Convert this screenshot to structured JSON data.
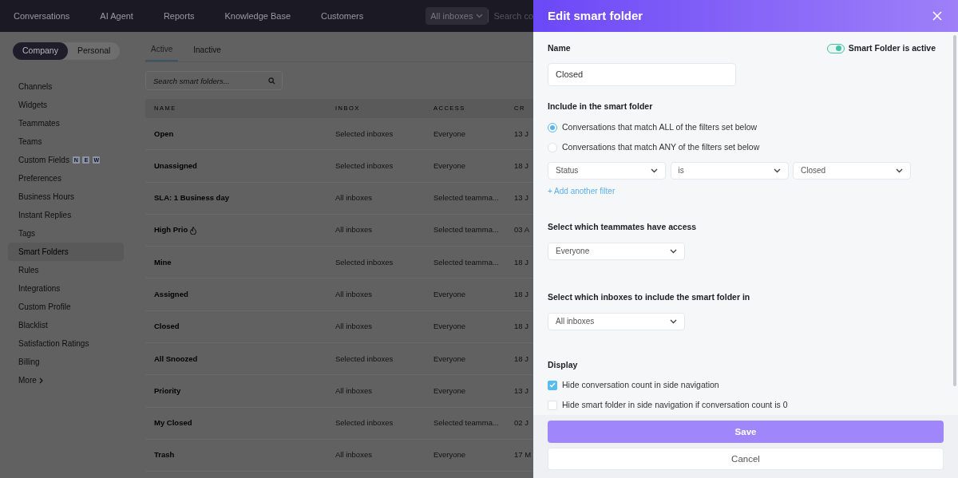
{
  "top_nav": {
    "items": [
      "Conversations",
      "AI Agent",
      "Reports",
      "Knowledge Base",
      "Customers"
    ],
    "inbox_select": "All inboxes",
    "search_placeholder": "Search co"
  },
  "scope_toggle": [
    {
      "label": "Company",
      "selected": true
    },
    {
      "label": "Personal",
      "selected": false
    }
  ],
  "sidebar": {
    "items": [
      {
        "label": "Channels",
        "selected": false
      },
      {
        "label": "Widgets",
        "selected": false
      },
      {
        "label": "Teammates",
        "selected": false
      },
      {
        "label": "Teams",
        "selected": false
      },
      {
        "label": "Custom Fields",
        "selected": false,
        "badge": [
          "N",
          "E",
          "W"
        ]
      },
      {
        "label": "Preferences",
        "selected": false
      },
      {
        "label": "Business Hours",
        "selected": false
      },
      {
        "label": "Instant Replies",
        "selected": false
      },
      {
        "label": "Tags",
        "selected": false
      },
      {
        "label": "Smart Folders",
        "selected": true
      },
      {
        "label": "Rules",
        "selected": false
      },
      {
        "label": "Integrations",
        "selected": false
      },
      {
        "label": "Custom Profile",
        "selected": false
      },
      {
        "label": "Blacklist",
        "selected": false
      },
      {
        "label": "Satisfaction Ratings",
        "selected": false
      },
      {
        "label": "Billing",
        "selected": false
      }
    ],
    "more": "More"
  },
  "tabs": [
    {
      "label": "Active",
      "selected": true
    },
    {
      "label": "Inactive",
      "selected": false
    }
  ],
  "search": {
    "placeholder": "Search smart folders..."
  },
  "table": {
    "columns": [
      "NAME",
      "INBOX",
      "ACCESS",
      "CR"
    ],
    "rows": [
      {
        "name": "Open",
        "inbox": "Selected inboxes",
        "access": "Everyone",
        "column_4": "13 J"
      },
      {
        "name": "Unassigned",
        "inbox": "Selected inboxes",
        "access": "Everyone",
        "column_4": "18 J"
      },
      {
        "name": "SLA: 1 Business day",
        "inbox": "All inboxes",
        "access": "Selected teamma...",
        "column_4": "13 J"
      },
      {
        "name": "High Prio",
        "flame": true,
        "inbox": "All inboxes",
        "access": "Selected teamma...",
        "column_4": "03 A"
      },
      {
        "name": "Mine",
        "inbox": "Selected inboxes",
        "access": "Selected teamma...",
        "column_4": "18 J"
      },
      {
        "name": "Assigned",
        "inbox": "All inboxes",
        "access": "Everyone",
        "column_4": "18 J"
      },
      {
        "name": "Closed",
        "inbox": "All inboxes",
        "access": "Everyone",
        "column_4": "18 J"
      },
      {
        "name": "All Snoozed",
        "inbox": "Selected inboxes",
        "access": "Everyone",
        "column_4": "18 J"
      },
      {
        "name": "Priority",
        "inbox": "All inboxes",
        "access": "Everyone",
        "column_4": "13 J"
      },
      {
        "name": "My Closed",
        "inbox": "Selected inboxes",
        "access": "Selected teamma...",
        "column_4": "02 J"
      },
      {
        "name": "Trash",
        "inbox": "All inboxes",
        "access": "Everyone",
        "column_4": "17 M"
      }
    ]
  },
  "panel": {
    "title": "Edit smart folder",
    "name_label": "Name",
    "name_value": "Closed",
    "active_toggle": {
      "label": "Smart Folder is active",
      "on": true
    },
    "include_label": "Include in the smart folder",
    "match_options": [
      {
        "label": "Conversations that match ALL of the filters set below",
        "selected": true
      },
      {
        "label": "Conversations that match ANY of the filters set below",
        "selected": false
      }
    ],
    "filter": [
      "Status",
      "is",
      "Closed"
    ],
    "add_filter": "+ Add another filter",
    "access": {
      "label": "Select which teammates have access",
      "value": "Everyone"
    },
    "inboxes": {
      "label": "Select which inboxes to include the smart folder in",
      "value": "All inboxes"
    },
    "display": {
      "label": "Display",
      "options": [
        {
          "label": "Hide conversation count in side navigation",
          "checked": true
        },
        {
          "label": "Hide smart folder in side navigation if conversation count is 0",
          "checked": false
        }
      ]
    },
    "save": "Save",
    "cancel": "Cancel"
  }
}
